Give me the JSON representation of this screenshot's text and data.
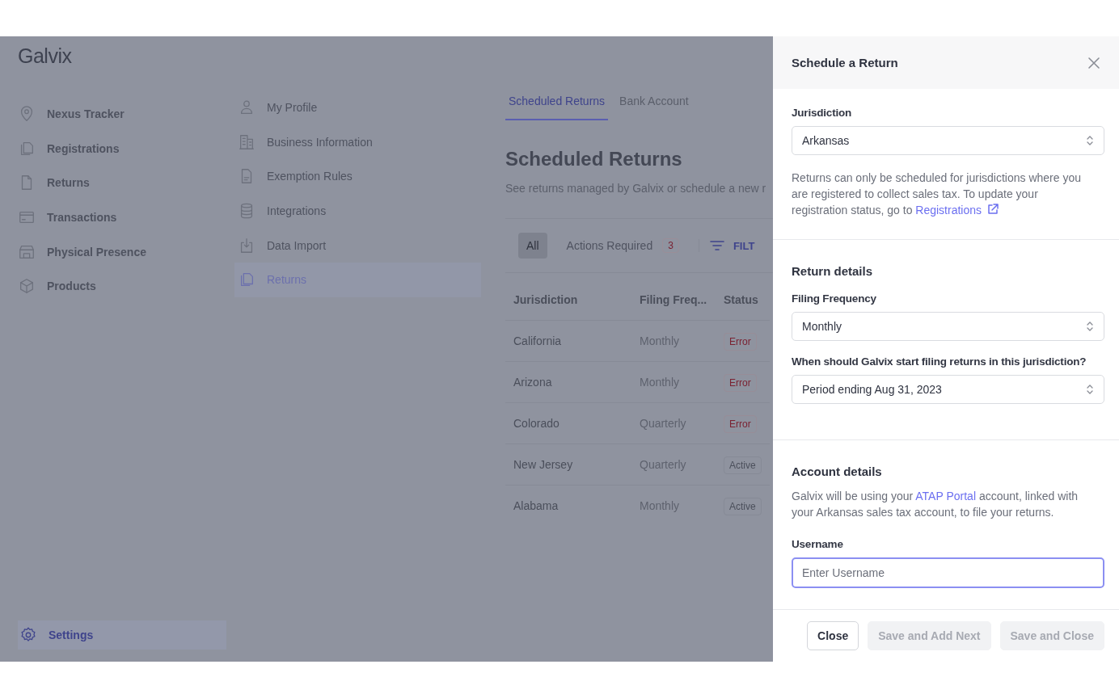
{
  "sidebar": {
    "logo": "Galvix",
    "items": [
      {
        "label": "Nexus Tracker",
        "selected": false
      },
      {
        "label": "Registrations",
        "selected": false
      },
      {
        "label": "Returns",
        "selected": false
      },
      {
        "label": "Transactions",
        "selected": false
      },
      {
        "label": "Physical Presence",
        "selected": false
      },
      {
        "label": "Products",
        "selected": false
      }
    ],
    "footer_item": {
      "label": "Settings",
      "selected": true
    }
  },
  "settings_menu": {
    "items": [
      {
        "label": "My Profile",
        "selected": false
      },
      {
        "label": "Business Information",
        "selected": false
      },
      {
        "label": "Exemption Rules",
        "selected": false
      },
      {
        "label": "Integrations",
        "selected": false
      },
      {
        "label": "Data Import",
        "selected": false
      },
      {
        "label": "Returns",
        "selected": true
      }
    ]
  },
  "tabs": [
    {
      "label": "Scheduled Returns",
      "selected": true
    },
    {
      "label": "Bank Account",
      "selected": false
    }
  ],
  "page": {
    "title": "Scheduled Returns",
    "description": "See returns managed by Galvix or schedule a new r"
  },
  "filters": {
    "chips": [
      {
        "label": "All",
        "selected": true
      },
      {
        "label": "Actions Required",
        "count": "3",
        "selected": false
      }
    ],
    "filter_button": "FILT"
  },
  "table": {
    "columns": [
      "Jurisdiction",
      "Filing Freq...",
      "Status"
    ],
    "rows": [
      {
        "jurisdiction": "California",
        "frequency": "Monthly",
        "status": "Error",
        "kind": "error"
      },
      {
        "jurisdiction": "Arizona",
        "frequency": "Monthly",
        "status": "Error",
        "kind": "error"
      },
      {
        "jurisdiction": "Colorado",
        "frequency": "Quarterly",
        "status": "Error",
        "kind": "error"
      },
      {
        "jurisdiction": "New Jersey",
        "frequency": "Quarterly",
        "status": "Active",
        "kind": "active"
      },
      {
        "jurisdiction": "Alabama",
        "frequency": "Monthly",
        "status": "Active",
        "kind": "active"
      }
    ]
  },
  "drawer": {
    "title": "Schedule a Return",
    "jurisdiction": {
      "label": "Jurisdiction",
      "value": "Arkansas",
      "help": "Returns can only be scheduled for jurisdictions where you are registered to collect sales tax. To update your registration status, go to",
      "link": "Registrations"
    },
    "return_details": {
      "heading": "Return details",
      "fields": [
        {
          "label": "Filing Frequency",
          "value": "Monthly"
        },
        {
          "label": "When should Galvix start filing returns in this jurisdiction?",
          "value": "Period ending Aug 31, 2023"
        }
      ]
    },
    "account_details": {
      "heading": "Account details",
      "text_before": "Galvix will be using your",
      "link": "ATAP Portal",
      "text_after": "account, linked with your Arkansas sales tax account, to file your returns.",
      "username_label": "Username",
      "username_placeholder": "Enter Username"
    },
    "buttons": [
      {
        "label": "Close",
        "disabled": false
      },
      {
        "label": "Save and Add Next",
        "disabled": true
      },
      {
        "label": "Save and Close",
        "disabled": true
      }
    ]
  }
}
